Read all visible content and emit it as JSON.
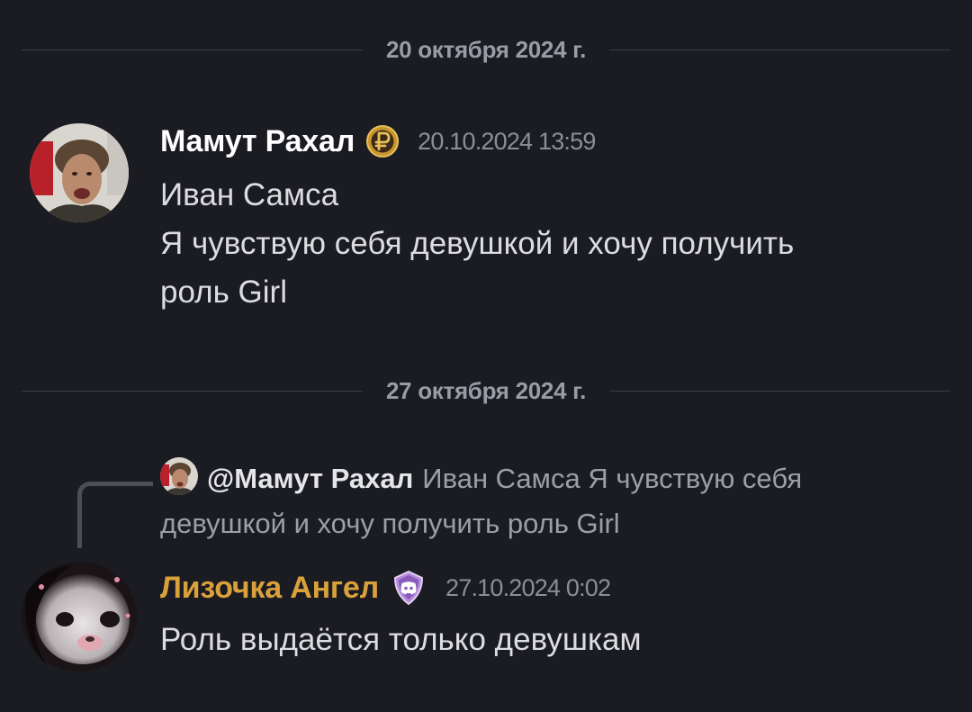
{
  "dividers": [
    {
      "date": "20 октября 2024 г."
    },
    {
      "date": "27 октября 2024 г."
    }
  ],
  "messages": [
    {
      "username": "Мамут Рахал",
      "username_color": "#ffffff",
      "badge_icon": "ruble-coin-icon",
      "timestamp": "20.10.2024 13:59",
      "lines": [
        "Иван Самса",
        "Я чувствую себя девушкой и хочу получить",
        "роль Girl"
      ]
    },
    {
      "reply": {
        "mention": "@Мамут Рахал",
        "preview_line1": "Иван Самса Я чувствую себя",
        "preview_line2": "девушкой и хочу получить роль Girl"
      },
      "username": "Лизочка Ангел",
      "username_color": "#d9a13c",
      "badge_icon": "discord-shield-icon",
      "timestamp": "27.10.2024 0:02",
      "lines": [
        "Роль выдаётся только девушкам"
      ]
    }
  ]
}
